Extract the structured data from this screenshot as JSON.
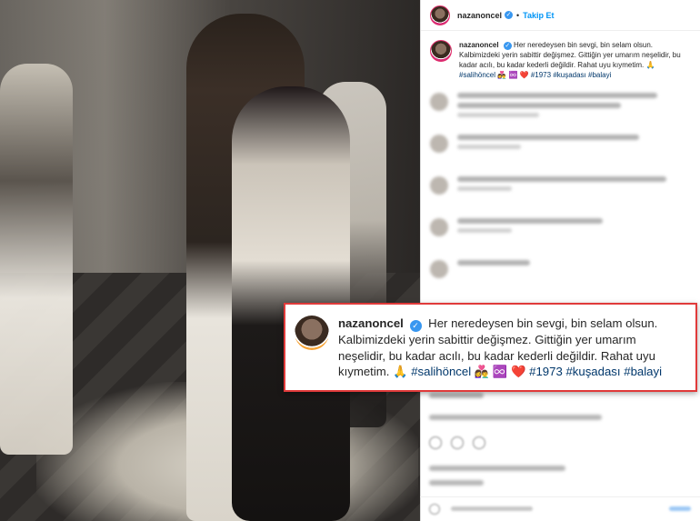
{
  "header": {
    "username": "nazanoncel",
    "separator": "•",
    "follow_label": "Takip Et"
  },
  "caption": {
    "username": "nazanoncel",
    "text": "Her neredeysen bin sevgi, bin selam olsun. Kalbimizdeki yerin sabittir değişmez. Gittiğin yer umarım neşelidir, bu kadar acılı, bu kadar kederli değildir. Rahat uyu kıymetim.",
    "emojis": "🙏 #",
    "tag1": "#salihöncel",
    "emojis2": "👩‍❤️‍👨 ♾️ ❤️",
    "tag2": "#1973",
    "tag3": "#kuşadası",
    "tag4": "#balayi"
  },
  "zoom": {
    "username": "nazanoncel",
    "text": "Her neredeysen bin sevgi, bin selam olsun. Kalbimizdeki yerin sabittir değişmez. Gittiğin yer umarım neşelidir, bu kadar acılı, bu kadar kederli değildir. Rahat uyu kıymetim.",
    "emoji_a": "🙏",
    "tag1": "#salihöncel",
    "emoji_b": "👩‍❤️‍👨 ♾️ ❤️",
    "tag2": "#1973",
    "tag3": "#kuşadası",
    "tag4": "#balayi"
  },
  "icons": {
    "verified": "✓"
  },
  "colors": {
    "link": "#00376b",
    "follow": "#0095f6",
    "verified": "#3897f0",
    "highlight_border": "#e03a3a"
  }
}
